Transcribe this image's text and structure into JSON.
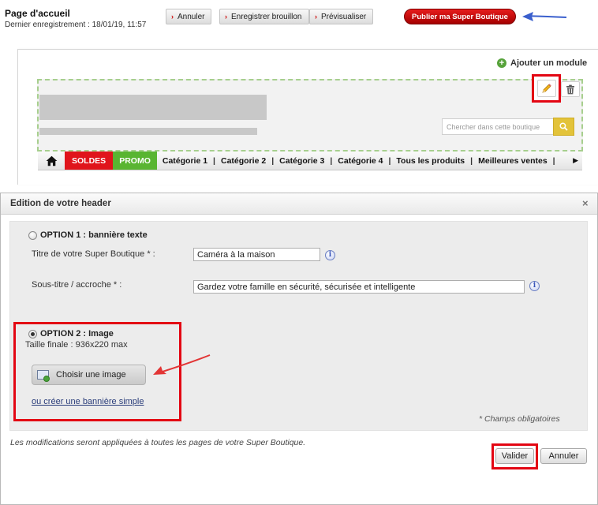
{
  "topbar": {
    "page_title": "Page d'accueil",
    "last_saved": "Dernier enregistrement : 18/01/19, 11:57",
    "buttons": {
      "cancel": "Annuler",
      "save_draft": "Enregistrer brouillon",
      "preview": "Prévisualiser",
      "publish": "Publier ma Super Boutique"
    }
  },
  "preview": {
    "add_module": "Ajouter un module",
    "search_placeholder": "Chercher dans cette boutique",
    "nav": {
      "soldes": "SOLDES",
      "promo": "PROMO",
      "items": [
        "Catégorie 1",
        "Catégorie 2",
        "Catégorie 3",
        "Catégorie 4",
        "Tous les produits",
        "Meilleures ventes"
      ]
    }
  },
  "dialog": {
    "title": "Edition de votre header",
    "close": "×",
    "option1": {
      "label": "OPTION 1 : bannière texte",
      "title_label": "Titre de votre Super Boutique * :",
      "title_value": "Caméra à la maison",
      "subtitle_label": "Sous-titre / accroche * :",
      "subtitle_value": "Gardez votre famille en sécurité, sécurisée et intelligente"
    },
    "option2": {
      "label": "OPTION 2 : Image",
      "size": "Taille finale : 936x220 max",
      "choose_button": "Choisir une image",
      "simple_link": "ou créer une bannière simple"
    },
    "required_note": "* Champs obligatoires",
    "footer_note": "Les modifications seront appliquées à toutes les pages de votre Super Boutique.",
    "validate": "Valider",
    "cancel": "Annuler"
  },
  "colors": {
    "highlight_red": "#e30613",
    "publish_red": "#c40000",
    "annotation_blue": "#3a5fcd",
    "soldes_red": "#e0141b",
    "promo_green": "#59b531",
    "search_yellow": "#e3c33a"
  }
}
